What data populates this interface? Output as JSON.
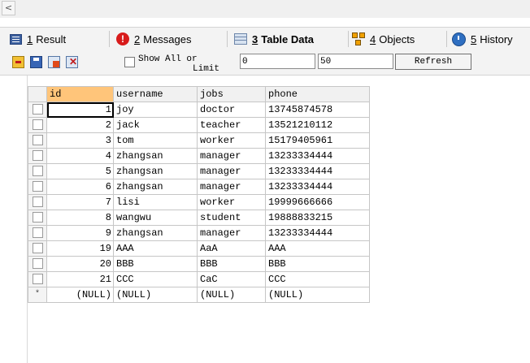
{
  "tabs": [
    {
      "num": "1",
      "label": "Result",
      "icon": "result-grid-icon"
    },
    {
      "num": "2",
      "label": "Messages",
      "icon": "messages-icon"
    },
    {
      "num": "3",
      "label": "Table Data",
      "icon": "table-data-icon",
      "active": true
    },
    {
      "num": "4",
      "label": "Objects",
      "icon": "objects-icon"
    },
    {
      "num": "5",
      "label": "History",
      "icon": "history-icon"
    }
  ],
  "toolbar": {
    "show_all_line1": "Show All or",
    "show_all_line2": "Limit",
    "offset_value": "0",
    "limit_value": "50",
    "refresh_label": "Refresh"
  },
  "grid": {
    "columns": [
      "id",
      "username",
      "jobs",
      "phone"
    ],
    "rows": [
      {
        "id": "1",
        "username": "joy",
        "jobs": "doctor",
        "phone": "13745874578"
      },
      {
        "id": "2",
        "username": "jack",
        "jobs": "teacher",
        "phone": "13521210112"
      },
      {
        "id": "3",
        "username": "tom",
        "jobs": "worker",
        "phone": "15179405961"
      },
      {
        "id": "4",
        "username": "zhangsan",
        "jobs": "manager",
        "phone": "13233334444"
      },
      {
        "id": "5",
        "username": "zhangsan",
        "jobs": "manager",
        "phone": "13233334444"
      },
      {
        "id": "6",
        "username": "zhangsan",
        "jobs": "manager",
        "phone": "13233334444"
      },
      {
        "id": "7",
        "username": "lisi",
        "jobs": "worker",
        "phone": "19999666666"
      },
      {
        "id": "8",
        "username": "wangwu",
        "jobs": "student",
        "phone": "19888833215"
      },
      {
        "id": "9",
        "username": "zhangsan",
        "jobs": "manager",
        "phone": "13233334444"
      },
      {
        "id": "19",
        "username": "AAA",
        "jobs": "AaA",
        "phone": "AAA"
      },
      {
        "id": "20",
        "username": "BBB",
        "jobs": "BBB",
        "phone": "BBB"
      },
      {
        "id": "21",
        "username": "CCC",
        "jobs": "CaC",
        "phone": "CCC"
      }
    ],
    "new_row": {
      "marker": "*",
      "id": "(NULL)",
      "username": "(NULL)",
      "jobs": "(NULL)",
      "phone": "(NULL)"
    }
  },
  "scroll_left_glyph": "<"
}
